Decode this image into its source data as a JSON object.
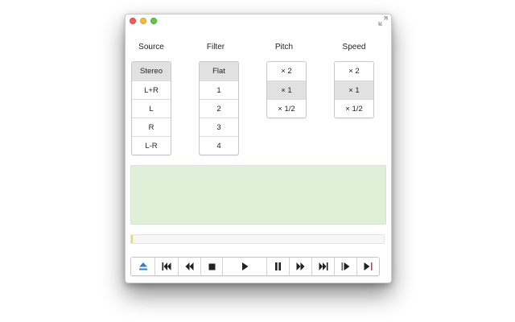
{
  "source": {
    "label": "Source",
    "selected": "Stereo",
    "options": [
      "Stereo",
      "L+R",
      "L",
      "R",
      "L-R"
    ]
  },
  "filter": {
    "label": "Filter",
    "selected": "Flat",
    "options": [
      "Flat",
      "1",
      "2",
      "3",
      "4"
    ]
  },
  "pitch": {
    "label": "Pitch",
    "selected": "× 1",
    "options": [
      "× 2",
      "× 1",
      "× 1/2"
    ]
  },
  "speed": {
    "label": "Speed",
    "selected": "× 1",
    "options": [
      "× 2",
      "× 1",
      "× 1/2"
    ]
  },
  "playback": {
    "progress": 0,
    "display_color": "#dfefd8"
  },
  "transport": {
    "buttons": [
      {
        "name": "eject",
        "icon": "eject-icon"
      },
      {
        "name": "skip-to-start",
        "icon": "skip-to-start-icon"
      },
      {
        "name": "rewind",
        "icon": "rewind-icon"
      },
      {
        "name": "stop",
        "icon": "stop-icon"
      },
      {
        "name": "play",
        "icon": "play-icon"
      },
      {
        "name": "pause",
        "icon": "pause-icon"
      },
      {
        "name": "fast-forward",
        "icon": "fast-forward-icon"
      },
      {
        "name": "skip-to-end",
        "icon": "skip-to-end-icon"
      },
      {
        "name": "mark-in",
        "icon": "mark-in-icon"
      },
      {
        "name": "mark-out",
        "icon": "mark-out-icon"
      }
    ]
  },
  "colors": {
    "eject_accent": "#2f7fd6",
    "mark_out_accent": "#e0303a",
    "selected_segment": "#e1e1e1"
  }
}
